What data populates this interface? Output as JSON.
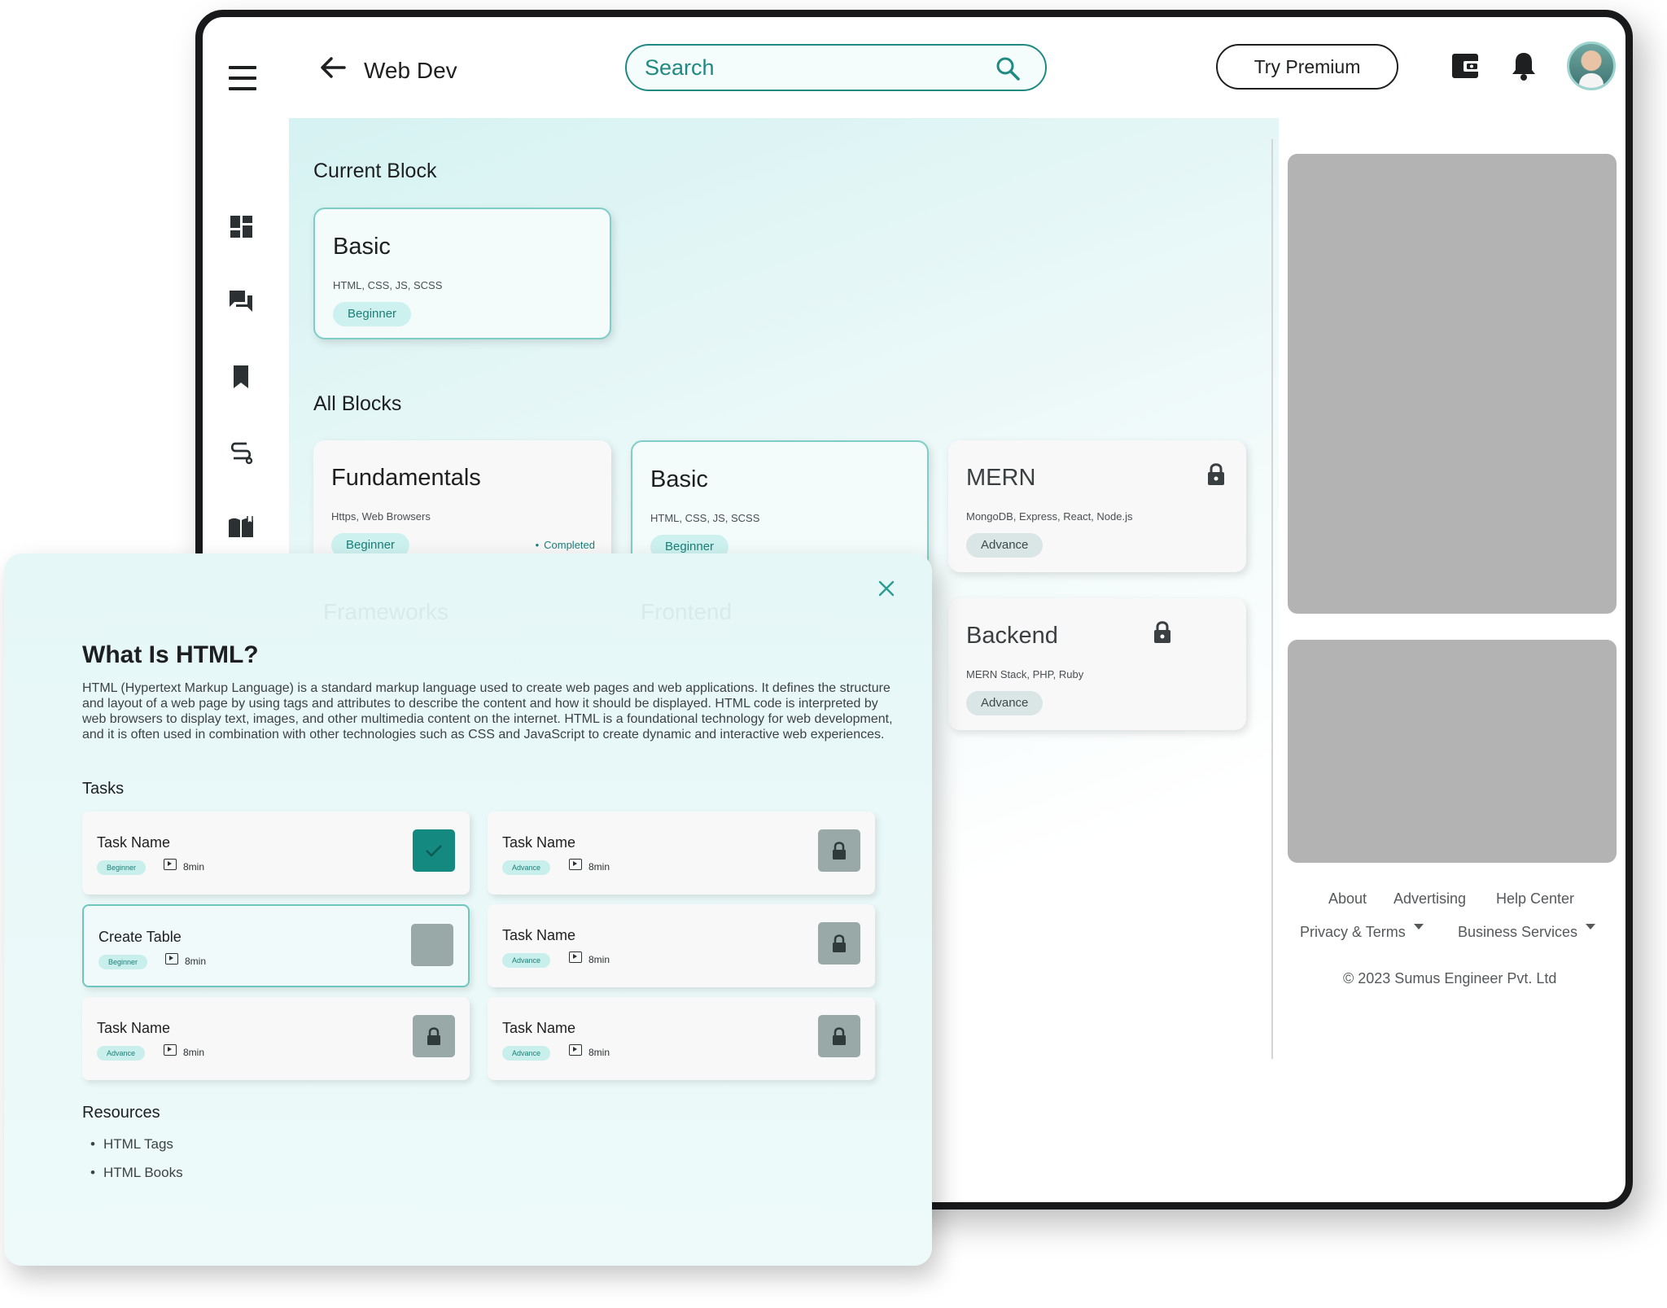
{
  "header": {
    "title": "Web Dev",
    "search_placeholder": "Search",
    "premium_label": "Try Premium"
  },
  "current_block": {
    "heading": "Current Block",
    "card": {
      "name": "Basic",
      "topics": "HTML, CSS, JS, SCSS",
      "level": "Beginner"
    }
  },
  "all_blocks": {
    "heading": "All Blocks",
    "cards": [
      {
        "name": "Fundamentals",
        "topics": "Https, Web Browsers",
        "level": "Beginner",
        "status": "Completed"
      },
      {
        "name": "Basic",
        "topics": "HTML, CSS, JS, SCSS",
        "level": "Beginner"
      },
      {
        "name": "MERN",
        "topics": "MongoDB, Express, React, Node.js",
        "level": "Advance",
        "locked": true
      },
      {
        "name": "Backend",
        "topics": "MERN Stack, PHP, Ruby",
        "level": "Advance",
        "locked": true
      }
    ],
    "hidden_cards": [
      "Frameworks",
      "Frontend"
    ]
  },
  "footer": {
    "links_row1": [
      "About",
      "Advertising",
      "Help Center"
    ],
    "links_row2": [
      "Privacy & Terms",
      "Business Services"
    ],
    "copyright": "© 2023 Sumus Engineer Pvt. Ltd"
  },
  "modal": {
    "title": "What Is HTML?",
    "description": "HTML (Hypertext Markup Language) is a standard markup language used to create web pages and web applications. It defines the structure and layout of a web page by using tags and attributes to describe the content and how it should be displayed. HTML code is interpreted by web browsers to display text, images, and other multimedia content on the internet. HTML is a foundational technology for web development, and it is often used in combination with other technologies such as CSS and JavaScript to create dynamic and interactive web experiences.",
    "tasks_heading": "Tasks",
    "tasks": [
      {
        "name": "Task Name",
        "level": "Beginner",
        "duration": "8min",
        "status": "done"
      },
      {
        "name": "Task Name",
        "level": "Advance",
        "duration": "8min",
        "status": "locked"
      },
      {
        "name": "Create Table",
        "level": "Beginner",
        "duration": "8min",
        "status": "pending"
      },
      {
        "name": "Task Name",
        "level": "Advance",
        "duration": "8min",
        "status": "locked"
      },
      {
        "name": "Task Name",
        "level": "Advance",
        "duration": "8min",
        "status": "locked"
      },
      {
        "name": "Task Name",
        "level": "Advance",
        "duration": "8min",
        "status": "locked"
      }
    ],
    "resources_heading": "Resources",
    "resources": [
      "HTML Tags",
      "HTML Books"
    ]
  },
  "colors": {
    "accent": "#1f8a82",
    "pill_bg": "#cdf1ef",
    "locked": "#98a9a8",
    "frame": "#17191b"
  },
  "icons": [
    "menu-icon",
    "back-arrow-icon",
    "search-icon",
    "wallet-icon",
    "bell-icon",
    "dashboard-icon",
    "chat-icon",
    "bookmark-icon",
    "route-icon",
    "book-icon",
    "lock-icon",
    "close-icon",
    "check-icon",
    "video-icon"
  ]
}
